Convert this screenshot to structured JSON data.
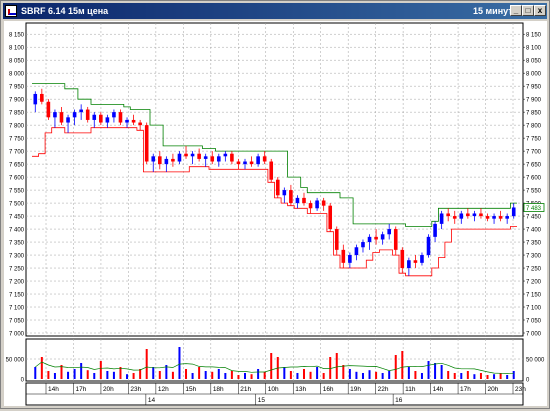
{
  "window": {
    "title": "SBRF 6.14 15м цена",
    "period": "15 минут",
    "buttons": {
      "minimize": "_",
      "maximize": "□",
      "close": "x"
    }
  },
  "colors": {
    "bull": "#0000ff",
    "bear": "#ff0000",
    "upper_channel": "#008000",
    "lower_channel": "#ff0000",
    "grid": "#a0a0a0",
    "last_price_box": "#008000"
  },
  "price_axis": {
    "ticks": [
      "8 150",
      "8 100",
      "8 050",
      "8 000",
      "7 950",
      "7 900",
      "7 850",
      "7 800",
      "7 750",
      "7 700",
      "7 650",
      "7 600",
      "7 550",
      "7 500",
      "7 450",
      "7 400",
      "7 350",
      "7 300",
      "7 250",
      "7 200",
      "7 150",
      "7 100",
      "7 050",
      "7 000"
    ],
    "last_price": "7 483"
  },
  "volume_axis": {
    "ticks": [
      "50 000",
      "0"
    ]
  },
  "time_axis": {
    "hours": [
      "14h",
      "17h",
      "20h",
      "23h",
      "12h",
      "15h",
      "18h",
      "21h",
      "10h",
      "13h",
      "16h",
      "19h",
      "22h",
      "11h",
      "14h",
      "17h",
      "20h",
      "23h"
    ],
    "days": [
      "14",
      "15",
      "16"
    ]
  },
  "chart_data": {
    "type": "candlestick",
    "ylim": [
      7000,
      8170
    ],
    "candles": [
      [
        7880,
        7930,
        7850,
        7920
      ],
      [
        7920,
        7940,
        7880,
        7890
      ],
      [
        7890,
        7900,
        7820,
        7830
      ],
      [
        7830,
        7860,
        7790,
        7850
      ],
      [
        7850,
        7870,
        7800,
        7810
      ],
      [
        7810,
        7840,
        7770,
        7830
      ],
      [
        7830,
        7860,
        7800,
        7850
      ],
      [
        7850,
        7880,
        7820,
        7860
      ],
      [
        7860,
        7870,
        7810,
        7820
      ],
      [
        7820,
        7850,
        7790,
        7840
      ],
      [
        7840,
        7850,
        7800,
        7810
      ],
      [
        7810,
        7840,
        7790,
        7830
      ],
      [
        7830,
        7860,
        7810,
        7850
      ],
      [
        7850,
        7860,
        7800,
        7810
      ],
      [
        7810,
        7830,
        7790,
        7820
      ],
      [
        7820,
        7840,
        7800,
        7810
      ],
      [
        7810,
        7820,
        7780,
        7800
      ],
      [
        7800,
        7810,
        7650,
        7660
      ],
      [
        7660,
        7690,
        7620,
        7680
      ],
      [
        7680,
        7700,
        7630,
        7650
      ],
      [
        7650,
        7680,
        7620,
        7670
      ],
      [
        7670,
        7690,
        7640,
        7660
      ],
      [
        7660,
        7700,
        7650,
        7690
      ],
      [
        7690,
        7720,
        7670,
        7680
      ],
      [
        7680,
        7700,
        7650,
        7690
      ],
      [
        7690,
        7710,
        7660,
        7670
      ],
      [
        7670,
        7690,
        7640,
        7680
      ],
      [
        7680,
        7700,
        7650,
        7660
      ],
      [
        7660,
        7690,
        7640,
        7680
      ],
      [
        7680,
        7700,
        7660,
        7690
      ],
      [
        7690,
        7700,
        7650,
        7660
      ],
      [
        7660,
        7670,
        7630,
        7650
      ],
      [
        7650,
        7670,
        7630,
        7660
      ],
      [
        7660,
        7680,
        7640,
        7650
      ],
      [
        7650,
        7690,
        7640,
        7680
      ],
      [
        7680,
        7700,
        7650,
        7660
      ],
      [
        7660,
        7670,
        7580,
        7590
      ],
      [
        7590,
        7600,
        7520,
        7530
      ],
      [
        7530,
        7560,
        7500,
        7550
      ],
      [
        7550,
        7570,
        7490,
        7500
      ],
      [
        7500,
        7530,
        7480,
        7520
      ],
      [
        7520,
        7540,
        7490,
        7500
      ],
      [
        7500,
        7510,
        7460,
        7480
      ],
      [
        7480,
        7520,
        7470,
        7510
      ],
      [
        7510,
        7520,
        7470,
        7490
      ],
      [
        7490,
        7500,
        7390,
        7400
      ],
      [
        7400,
        7410,
        7300,
        7320
      ],
      [
        7320,
        7340,
        7250,
        7270
      ],
      [
        7270,
        7310,
        7250,
        7300
      ],
      [
        7300,
        7340,
        7280,
        7330
      ],
      [
        7330,
        7360,
        7310,
        7350
      ],
      [
        7350,
        7380,
        7320,
        7370
      ],
      [
        7370,
        7400,
        7340,
        7360
      ],
      [
        7360,
        7390,
        7340,
        7380
      ],
      [
        7380,
        7420,
        7360,
        7400
      ],
      [
        7400,
        7410,
        7300,
        7320
      ],
      [
        7320,
        7330,
        7230,
        7250
      ],
      [
        7250,
        7290,
        7220,
        7280
      ],
      [
        7280,
        7300,
        7250,
        7270
      ],
      [
        7270,
        7310,
        7260,
        7300
      ],
      [
        7300,
        7380,
        7290,
        7370
      ],
      [
        7370,
        7430,
        7350,
        7420
      ],
      [
        7420,
        7470,
        7400,
        7460
      ],
      [
        7460,
        7480,
        7430,
        7450
      ],
      [
        7450,
        7470,
        7420,
        7440
      ],
      [
        7440,
        7470,
        7420,
        7460
      ],
      [
        7460,
        7480,
        7440,
        7450
      ],
      [
        7450,
        7470,
        7430,
        7460
      ],
      [
        7460,
        7480,
        7440,
        7450
      ],
      [
        7450,
        7460,
        7430,
        7440
      ],
      [
        7440,
        7460,
        7420,
        7450
      ],
      [
        7450,
        7470,
        7430,
        7440
      ],
      [
        7440,
        7460,
        7420,
        7450
      ],
      [
        7450,
        7500,
        7440,
        7483
      ]
    ],
    "upper_channel": [
      7960,
      7960,
      7960,
      7960,
      7960,
      7940,
      7940,
      7900,
      7900,
      7880,
      7880,
      7880,
      7880,
      7880,
      7870,
      7860,
      7860,
      7860,
      7800,
      7800,
      7720,
      7720,
      7720,
      7720,
      7720,
      7720,
      7710,
      7710,
      7700,
      7700,
      7700,
      7700,
      7700,
      7700,
      7700,
      7700,
      7700,
      7700,
      7700,
      7600,
      7600,
      7560,
      7540,
      7540,
      7540,
      7540,
      7540,
      7520,
      7520,
      7420,
      7420,
      7420,
      7420,
      7420,
      7420,
      7420,
      7420,
      7410,
      7410,
      7410,
      7410,
      7430,
      7480,
      7480,
      7480,
      7480,
      7480,
      7480,
      7480,
      7480,
      7480,
      7480,
      7480,
      7500
    ],
    "lower_channel": [
      7680,
      7690,
      7770,
      7790,
      7790,
      7770,
      7770,
      7770,
      7770,
      7790,
      7790,
      7790,
      7790,
      7790,
      7790,
      7790,
      7780,
      7620,
      7620,
      7620,
      7620,
      7620,
      7620,
      7620,
      7640,
      7640,
      7640,
      7630,
      7630,
      7630,
      7630,
      7630,
      7630,
      7630,
      7630,
      7630,
      7580,
      7520,
      7500,
      7490,
      7480,
      7480,
      7460,
      7460,
      7460,
      7390,
      7300,
      7250,
      7250,
      7250,
      7250,
      7280,
      7310,
      7320,
      7320,
      7300,
      7230,
      7220,
      7220,
      7220,
      7220,
      7250,
      7290,
      7350,
      7400,
      7400,
      7400,
      7400,
      7400,
      7400,
      7400,
      7400,
      7400,
      7410
    ],
    "volumes": [
      30000,
      55000,
      20000,
      15000,
      35000,
      18000,
      25000,
      40000,
      22000,
      15000,
      45000,
      20000,
      18000,
      30000,
      12000,
      15000,
      25000,
      75000,
      30000,
      20000,
      35000,
      18000,
      80000,
      25000,
      15000,
      30000,
      20000,
      18000,
      25000,
      15000,
      20000,
      10000,
      15000,
      12000,
      25000,
      18000,
      65000,
      55000,
      30000,
      20000,
      15000,
      25000,
      18000,
      30000,
      15000,
      55000,
      65000,
      35000,
      25000,
      18000,
      15000,
      22000,
      18000,
      15000,
      20000,
      60000,
      70000,
      30000,
      20000,
      15000,
      45000,
      40000,
      35000,
      20000,
      15000,
      15000,
      20000,
      12000,
      15000,
      10000,
      12000,
      15000,
      10000,
      20000
    ],
    "volume_ylim": [
      0,
      90000
    ]
  }
}
